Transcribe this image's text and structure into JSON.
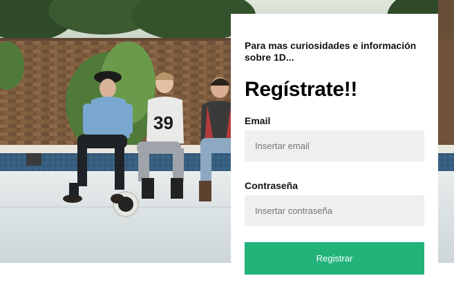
{
  "form": {
    "intro": "Para mas curiosidades e información sobre 1D...",
    "title": "Regístrate!!",
    "email_label": "Email",
    "email_placeholder": "Insertar email",
    "password_label": "Contraseña",
    "password_placeholder": "Insertar contraseña",
    "submit_label": "Registrar"
  },
  "photo": {
    "shirt_text": "39"
  },
  "colors": {
    "button": "#22b37b",
    "input_bg": "#efefef",
    "card_bg": "#ffffff"
  }
}
